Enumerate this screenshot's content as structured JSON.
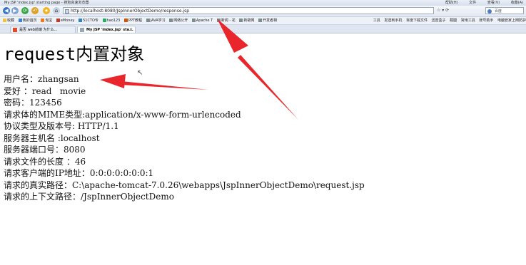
{
  "window": {
    "title": "My JSP 'index.jsp' starting page - 搜狗高速浏览器",
    "menu": [
      "帮助(H)",
      "文件",
      "查看(V)",
      "收藏(A)"
    ]
  },
  "navbar": {
    "address": "http://localhost:8080/JspInnerObjectDemo/response.jsp",
    "right_controls": "☆ ▾ ⟳",
    "search_label": "百度"
  },
  "bookmarks": {
    "left": [
      "收藏",
      "我的首页",
      "淘宝",
      "eMoney",
      "51CTO专",
      "hao123",
      "PPT教程",
      "JAVA学习",
      "网络公开",
      "Apache T",
      "新闻 - 花",
      "新歌网",
      "开发者相"
    ],
    "right": [
      "工具",
      "发送到手机",
      "百度下载文件",
      "迅雷盒子",
      "截图",
      "常用工具",
      "账号助手",
      "电脑管家上网防护"
    ]
  },
  "tabs": [
    {
      "label": "是否 web前端 为什么...",
      "active": false
    },
    {
      "label": "My JSP 'index.jsp' sta...",
      "active": true
    }
  ],
  "page": {
    "heading": "request内置对象",
    "lines": [
      "用户名：zhangsan",
      "爱好 ：read   movie",
      "密码：123456",
      "请求体的MIME类型:application/x-www-form-urlencoded",
      "协议类型及版本号: HTTP/1.1",
      "服务器主机名 :localhost",
      "服务器端口号：8080",
      "请求文件的长度 ：46",
      "请求客户端的IP地址：0:0:0:0:0:0:0:1",
      "请求的真实路径：C:\\apache-tomcat-7.0.26\\webapps\\JspInnerObjectDemo\\request.jsp",
      "请求的上下文路径：/JspInnerObjectDemo"
    ]
  },
  "annotation_color": "#e8262c"
}
